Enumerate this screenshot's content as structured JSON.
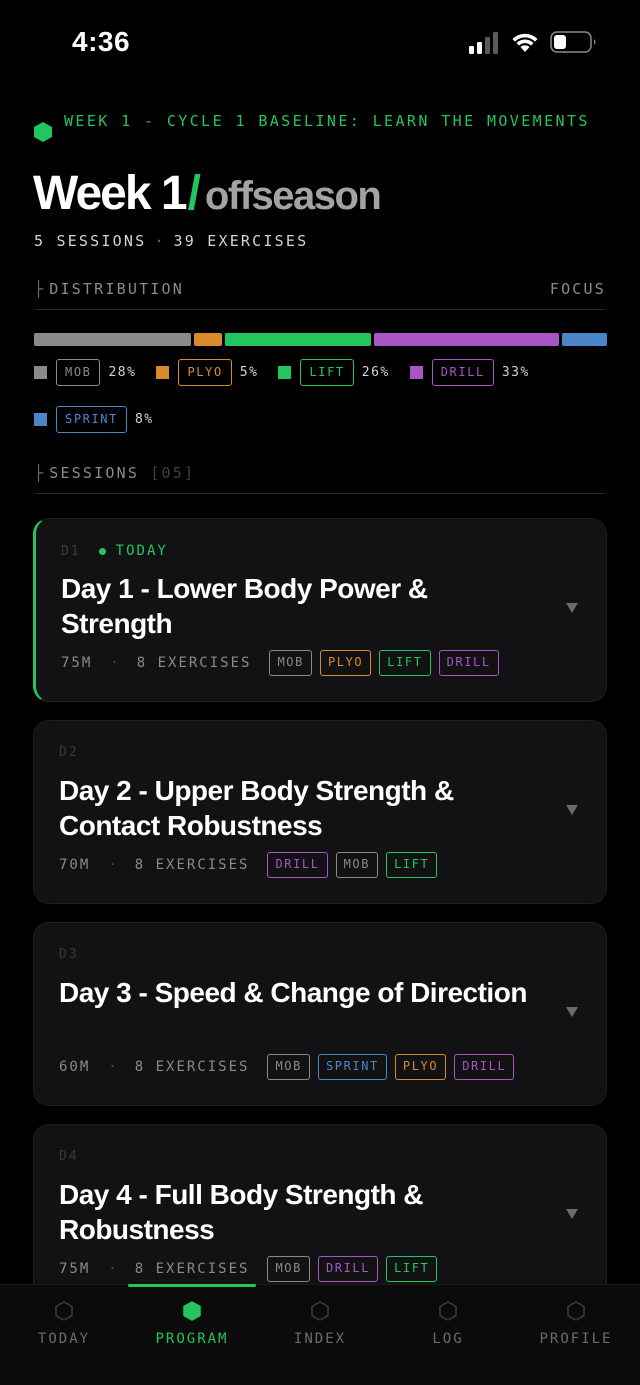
{
  "status": {
    "time": "4:36"
  },
  "header": {
    "eyebrow": "WEEK 1 - CYCLE 1 BASELINE: LEARN THE MOVEMENTS",
    "title_main": "Week 1",
    "title_slash": "/",
    "title_sub": "offseason",
    "sessions_count": "5 SESSIONS",
    "exercises_count": "39 EXERCISES",
    "meta_sep": "·"
  },
  "distribution": {
    "label": "DISTRIBUTION",
    "right_label": "FOCUS",
    "tick": "├",
    "categories": [
      {
        "key": "mob",
        "label": "MOB",
        "pct_label": "28%",
        "value": 28,
        "color": "#8a8a8a"
      },
      {
        "key": "plyo",
        "label": "PLYO",
        "pct_label": "5%",
        "value": 5,
        "color": "#d98a2b"
      },
      {
        "key": "lift",
        "label": "LIFT",
        "pct_label": "26%",
        "value": 26,
        "color": "#22c55e"
      },
      {
        "key": "drill",
        "label": "DRILL",
        "pct_label": "33%",
        "value": 33,
        "color": "#a855c7"
      },
      {
        "key": "sprint",
        "label": "SPRINT",
        "pct_label": "8%",
        "value": 8,
        "color": "#4a86c8"
      }
    ]
  },
  "sessions": {
    "label": "SESSIONS",
    "count": "[05]",
    "tick": "├",
    "items": [
      {
        "day": "D1",
        "today_label": "TODAY",
        "is_today": true,
        "title": "Day 1 - Lower Body Power & Strength",
        "duration": "75M",
        "exercises": "8 EXERCISES",
        "tags": [
          "mob",
          "plyo",
          "lift",
          "drill"
        ]
      },
      {
        "day": "D2",
        "today_label": "",
        "is_today": false,
        "title": "Day 2 - Upper Body Strength & Contact Robustness",
        "duration": "70M",
        "exercises": "8 EXERCISES",
        "tags": [
          "drill",
          "mob",
          "lift"
        ]
      },
      {
        "day": "D3",
        "today_label": "",
        "is_today": false,
        "title": "Day 3 - Speed & Change of Direction",
        "duration": "60M",
        "exercises": "8 EXERCISES",
        "tags": [
          "mob",
          "sprint",
          "plyo",
          "drill"
        ]
      },
      {
        "day": "D4",
        "today_label": "",
        "is_today": false,
        "title": "Day 4 - Full Body Strength & Robustness",
        "duration": "75M",
        "exercises": "8 EXERCISES",
        "tags": [
          "mob",
          "drill",
          "lift"
        ]
      }
    ],
    "meta_sep": "·"
  },
  "tabbar": {
    "active": "program",
    "tabs": [
      {
        "key": "today",
        "label": "TODAY"
      },
      {
        "key": "program",
        "label": "PROGRAM"
      },
      {
        "key": "index",
        "label": "INDEX"
      },
      {
        "key": "log",
        "label": "LOG"
      },
      {
        "key": "profile",
        "label": "PROFILE"
      }
    ]
  },
  "colors": {
    "accent": "#22c55e",
    "background": "#000000",
    "card": "#121214"
  }
}
